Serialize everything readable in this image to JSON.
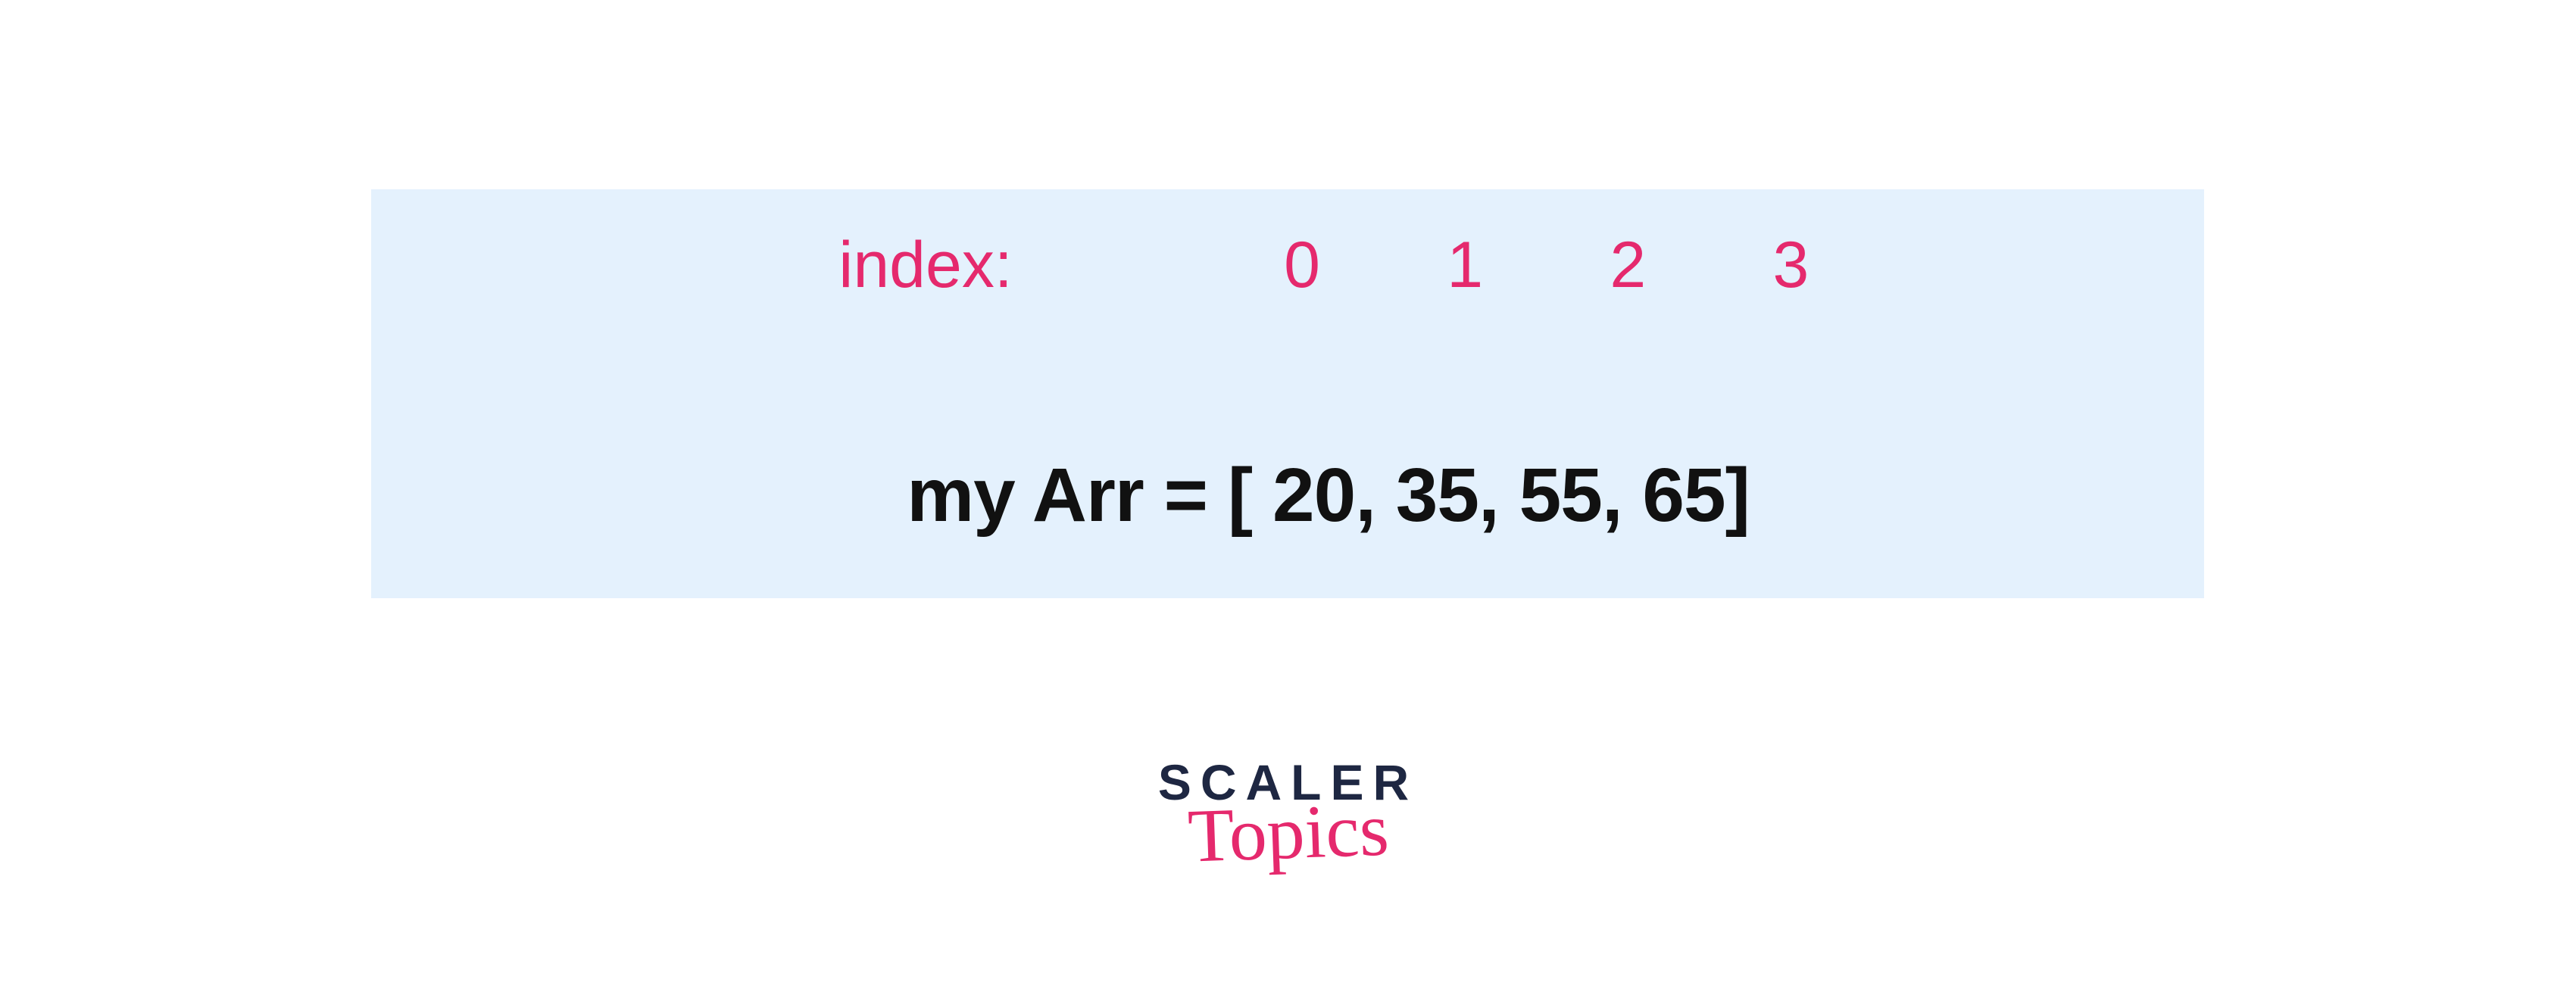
{
  "diagram": {
    "index_label": "index:",
    "indices": [
      "0",
      "1",
      "2",
      "3"
    ],
    "array_var": "my Arr",
    "array_equals": "=",
    "array_open": "[",
    "array_values": [
      "20",
      "35",
      "55",
      "65"
    ],
    "array_close": "]"
  },
  "logo": {
    "line1": "SCALER",
    "line2": "Topics"
  },
  "colors": {
    "accent": "#e5296d",
    "box_bg": "#e4f1fd",
    "text": "#111111",
    "logo_dark": "#1e2742"
  }
}
